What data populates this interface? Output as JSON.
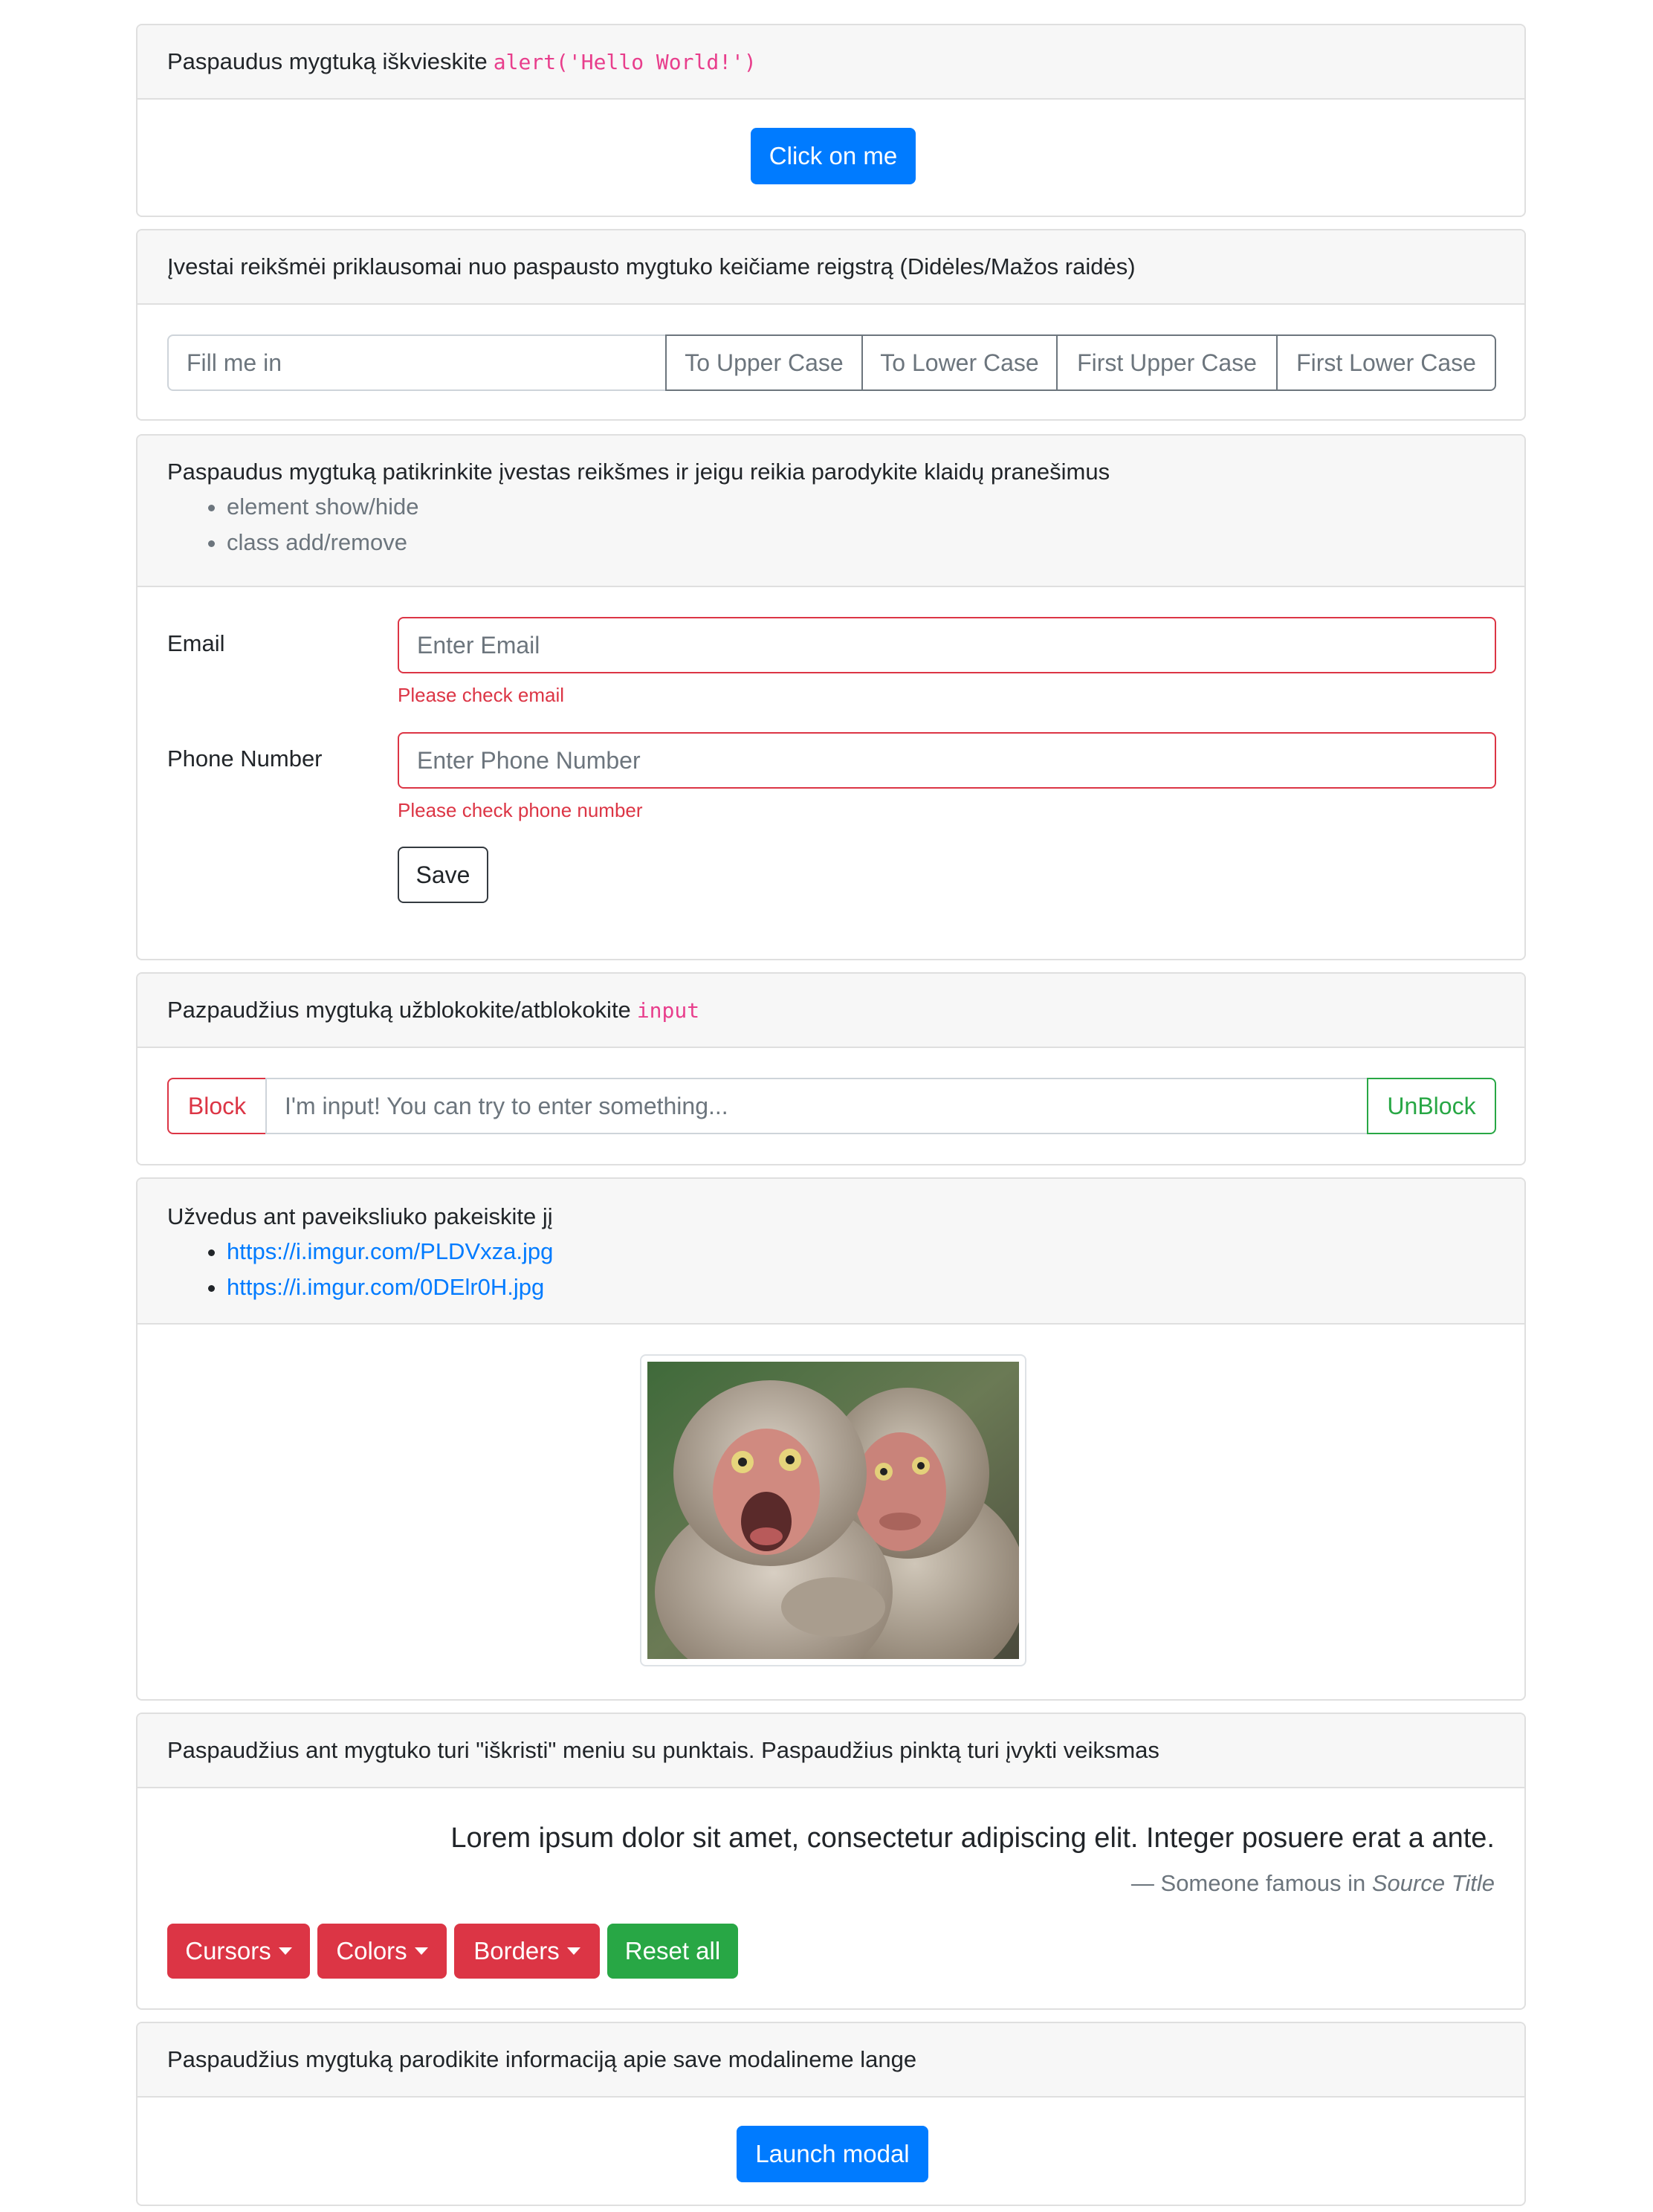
{
  "section1": {
    "header_text": "Paspaudus mygtuką iškvieskite",
    "header_code": "alert('Hello World!')",
    "button_label": "Click on me"
  },
  "section2": {
    "header_text": "Įvestai reikšmėi priklausomai nuo paspausto mygtuko keičiame reigstrą (Didėles/Mažos raidės)",
    "input_placeholder": "Fill me in",
    "buttons": [
      "To Upper Case",
      "To Lower Case",
      "First Upper Case",
      "First Lower Case"
    ]
  },
  "section3": {
    "header_text": "Paspaudus mygtuką patikrinkite įvestas reikšmes ir jeigu reikia parodykite klaidų pranešimus",
    "hints": [
      "element show/hide",
      "class add/remove"
    ],
    "email_label": "Email",
    "email_placeholder": "Enter Email",
    "email_error": "Please check email",
    "phone_label": "Phone Number",
    "phone_placeholder": "Enter Phone Number",
    "phone_error": "Please check phone number",
    "save_label": "Save"
  },
  "section4": {
    "header_text": "Pazpaudžius mygtuką užblokokite/atblokokite",
    "header_code": "input",
    "block_label": "Block",
    "input_placeholder": "I'm input! You can try to enter something...",
    "unblock_label": "UnBlock"
  },
  "section5": {
    "header_text": "Užvedus ant paveiksliuko pakeiskite jį",
    "links": [
      "https://i.imgur.com/PLDVxza.jpg",
      "https://i.imgur.com/0DElr0H.jpg"
    ]
  },
  "section6": {
    "header_text": "Paspaudžius ant mygtuko turi \"iškristi\" meniu su punktais. Paspaudžius pinktą turi įvykti veiksmas",
    "quote": "Lorem ipsum dolor sit amet, consectetur adipiscing elit. Integer posuere erat a ante.",
    "footer_prefix": "— Someone famous in",
    "footer_source": "Source Title",
    "buttons": [
      "Cursors",
      "Colors",
      "Borders"
    ],
    "reset_label": "Reset all"
  },
  "section7": {
    "header_text": "Paspaudžius mygtuką parodikite informaciją apie save modalineme lange",
    "button_label": "Launch modal"
  },
  "colors": {
    "primary": "#007bff",
    "danger": "#dc3545",
    "success": "#28a745",
    "code": "#e83e8c"
  }
}
